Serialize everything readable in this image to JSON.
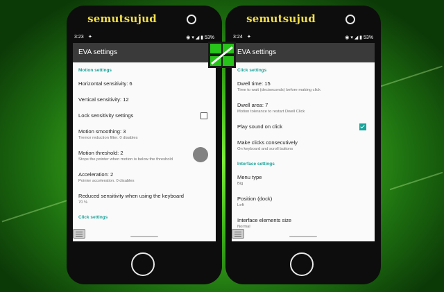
{
  "watermark": "semutsujud",
  "left_phone": {
    "status": {
      "time": "3:23",
      "battery": "53%"
    },
    "title": "EVA settings",
    "categories": {
      "motion": "Motion settings",
      "click": "Click settings"
    },
    "items": [
      {
        "title": "Horizontal sensitivity: 6",
        "summary": ""
      },
      {
        "title": "Vertical sensitivity: 12",
        "summary": ""
      },
      {
        "title": "Lock sensitivity settings",
        "summary": "",
        "checked": false
      },
      {
        "title": "Motion smoothing: 3",
        "summary": "Tremor reduction filter. 0 disables"
      },
      {
        "title": "Motion threshold: 2",
        "summary": "Stops the pointer when motion is below the threshold"
      },
      {
        "title": "Acceleration: 2",
        "summary": "Pointer acceleration. 0 disables"
      },
      {
        "title": "Reduced sensitivity when using the keyboard",
        "summary": "70 %"
      }
    ]
  },
  "right_phone": {
    "status": {
      "time": "3:24",
      "battery": "53%"
    },
    "title": "EVA settings",
    "categories": {
      "click": "Click settings",
      "interface": "Interface settings"
    },
    "items": [
      {
        "title": "Dwell time: 15",
        "summary": "Time to wait (deciseconds) before making click"
      },
      {
        "title": "Dwell area: 7",
        "summary": "Motion tolerance to restart Dwell Click"
      },
      {
        "title": "Play sound on click",
        "summary": "",
        "checked": true
      },
      {
        "title": "Make clicks consecutively",
        "summary": "On keyboard and scroll buttons"
      },
      {
        "title": "Menu type",
        "summary": "Big"
      },
      {
        "title": "Position (dock)",
        "summary": "Left"
      },
      {
        "title": "Interface elements size",
        "summary": "Normal"
      }
    ]
  },
  "colors": {
    "accent": "#1aa39a",
    "appbar": "#3a3a3a",
    "brand_text": "#f4e04a"
  },
  "icons": [
    "twitter-icon",
    "eye-icon",
    "wifi-icon",
    "signal-icon",
    "battery-icon",
    "floating-menu-icon",
    "pointer-cursor-icon"
  ]
}
